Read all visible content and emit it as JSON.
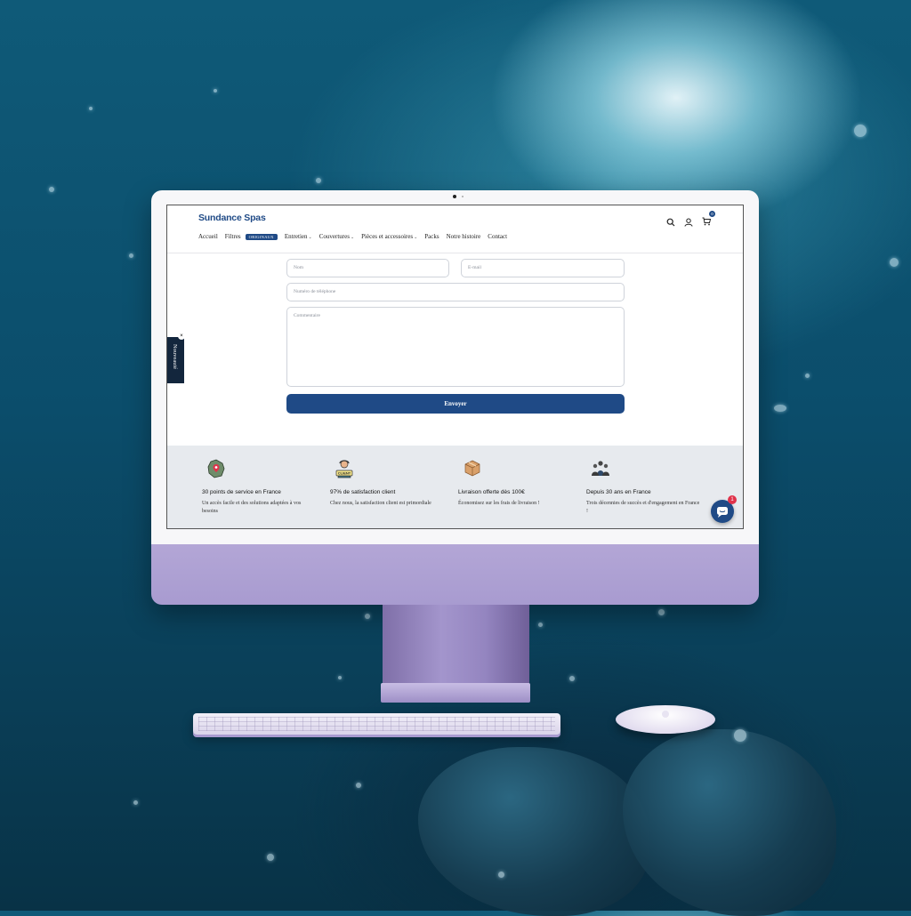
{
  "site": {
    "logo": "Sundance Spas",
    "nav": [
      {
        "label": "Accueil"
      },
      {
        "label": "Filtres",
        "badge": "ORIGINAUX"
      },
      {
        "label": "Entretien",
        "dropdown": true
      },
      {
        "label": "Couvertures",
        "dropdown": true
      },
      {
        "label": "Pièces et accessoires",
        "dropdown": true
      },
      {
        "label": "Packs"
      },
      {
        "label": "Notre histoire"
      },
      {
        "label": "Contact"
      }
    ],
    "cart_count": "0",
    "header_icons": [
      "search-icon",
      "user-icon",
      "cart-icon"
    ]
  },
  "form": {
    "name_placeholder": "Nom",
    "email_placeholder": "E-mail",
    "phone_placeholder": "Numéro de téléphone",
    "comment_placeholder": "Commentaire",
    "submit_label": "Envoyer"
  },
  "side_tab": {
    "label": "Nouveauté",
    "close": "×"
  },
  "features": [
    {
      "icon": "france-map-pin-icon",
      "title": "30 points de service en France",
      "desc": "Un accès facile et des solutions adaptées à vos besoins"
    },
    {
      "icon": "client-support-icon",
      "title": "97% de satisfaction client",
      "desc": "Chez nous, la satisfaction client est primordiale"
    },
    {
      "icon": "delivery-box-icon",
      "title": "Livraison offerte dès 100€",
      "desc": "Économisez sur les frais de livraison !"
    },
    {
      "icon": "team-icon",
      "title": "Depuis 30 ans en France",
      "desc": "Trois décennies de succès et d'engagement en France !"
    }
  ],
  "chat": {
    "unread": "1"
  },
  "colors": {
    "brand": "#1f4a86",
    "chin": "#a89bd0",
    "water": "#0b4d6b",
    "badge_red": "#e0324a"
  }
}
